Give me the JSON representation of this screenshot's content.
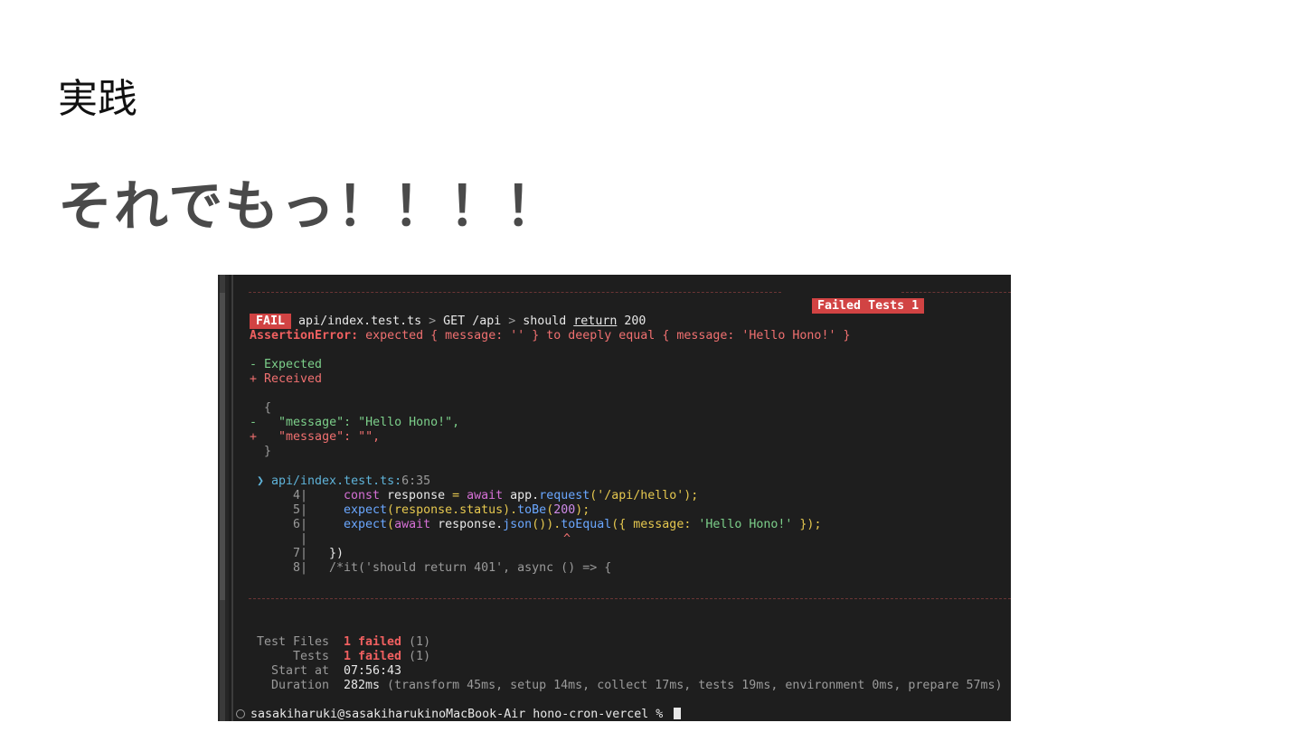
{
  "slide": {
    "kicker": "実践",
    "title": "それでもっ！！！！"
  },
  "terminal": {
    "failed_tests_badge": "Failed Tests 1",
    "fail_badge": "FAIL",
    "test_path_file": "api/index.test.ts",
    "test_path_sep1": " > ",
    "test_path_describe": "GET /api",
    "test_path_sep2": " > ",
    "test_path_should": "should ",
    "test_path_return": "return",
    "test_path_code": " 200",
    "assertion_label": "AssertionError:",
    "assertion_msg": " expected { message: '' } to deeply equal { message: 'Hello Hono!' }",
    "diff_expected": "- Expected",
    "diff_received": "+ Received",
    "obj_open": "  {",
    "diff_minus_prefix": "-   ",
    "diff_minus_line": "\"message\": \"Hello Hono!\",",
    "diff_plus_prefix": "+   ",
    "diff_plus_line": "\"message\": \"\",",
    "obj_close": "  }",
    "loc_arrow": "❯ ",
    "loc_file": "api/index.test.ts:",
    "loc_pos": "6:35",
    "code": {
      "l4_num": "4|",
      "l4_const": "const",
      "l4_response": " response ",
      "l4_eq": "=",
      "l4_await": " await",
      "l4_app": " app.",
      "l4_request": "request",
      "l4_arg": "('/api/hello');",
      "l5_num": "5|",
      "l5_expect": "expect",
      "l5_arg": "(response.status).",
      "l5_tobe": "toBe",
      "l5_open": "(",
      "l5_200": "200",
      "l5_close": ");",
      "l6_num": "6|",
      "l6_expect": "expect",
      "l6_open": "(",
      "l6_await": "await",
      "l6_resp": " response.",
      "l6_json": "json",
      "l6_close": "()).",
      "l6_toequal": "toEqual",
      "l6_obj": "({ message: ",
      "l6_str": "'Hello Hono!'",
      "l6_end": " });",
      "caret_pipe": "|",
      "caret": "^",
      "l7_num": "7|",
      "l7_code": "  })",
      "l8_num": "8|",
      "l8_code": "  /*it('should return 401', async () => {"
    },
    "summary": {
      "files_label": "Test Files",
      "files_value": "1 failed",
      "files_count": " (1)",
      "tests_label": "Tests",
      "tests_value": "1 failed",
      "tests_count": " (1)",
      "start_label": "Start at",
      "start_value": "07:56:43",
      "duration_label": "Duration",
      "duration_value": "282ms",
      "duration_detail": " (transform 45ms, setup 14ms, collect 17ms, tests 19ms, environment 0ms, prepare 57ms)"
    },
    "prompt": "sasakiharuki@sasakiharukinoMacBook-Air hono-cron-vercel % "
  }
}
